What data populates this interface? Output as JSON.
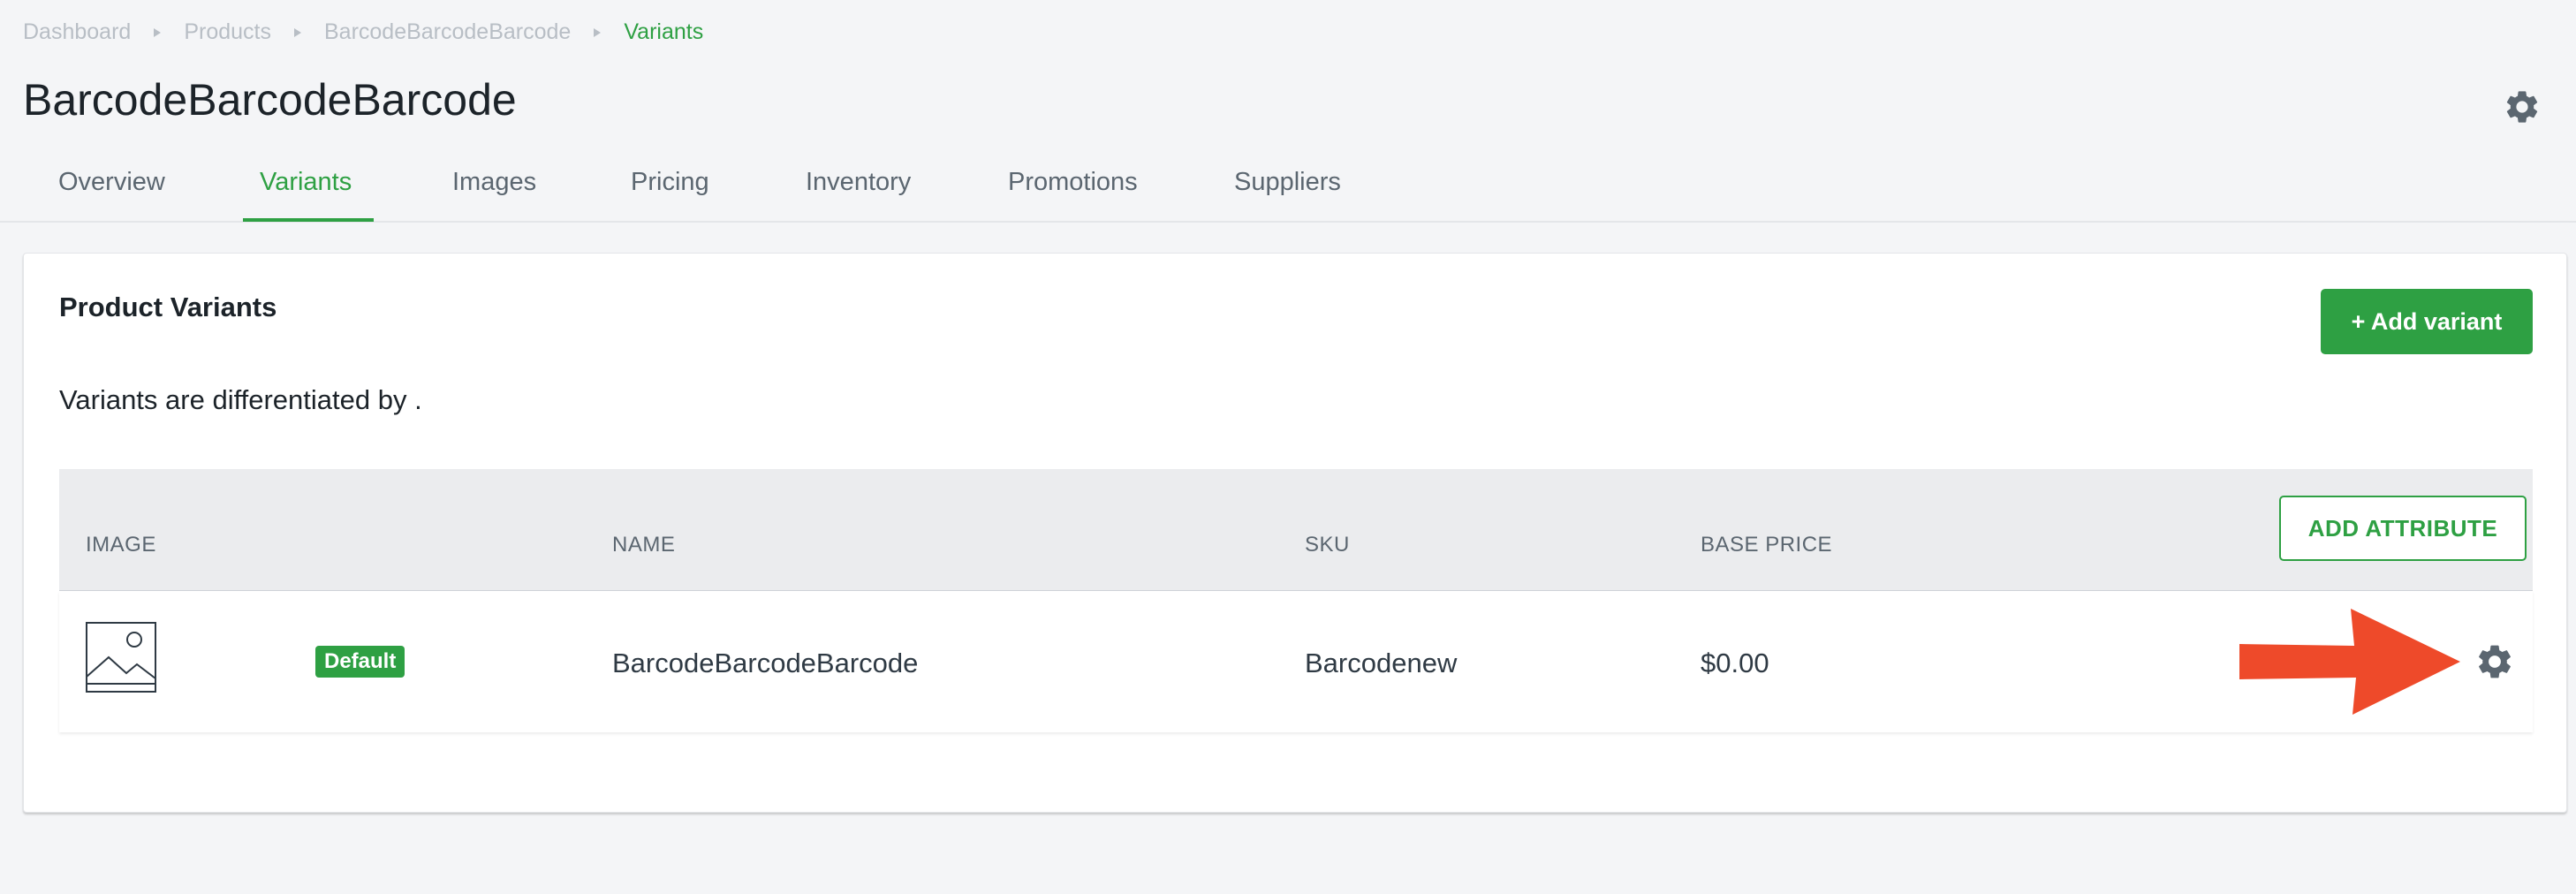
{
  "breadcrumb": [
    "Dashboard",
    "Products",
    "BarcodeBarcodeBarcode",
    "Variants"
  ],
  "page": {
    "title": "BarcodeBarcodeBarcode",
    "settings_icon": "gear-icon"
  },
  "tabs": [
    {
      "label": "Overview"
    },
    {
      "label": "Variants",
      "active": true
    },
    {
      "label": "Images"
    },
    {
      "label": "Pricing"
    },
    {
      "label": "Inventory"
    },
    {
      "label": "Promotions"
    },
    {
      "label": "Suppliers"
    }
  ],
  "card": {
    "title": "Product Variants",
    "add_variant_label": "+ Add variant",
    "differentiated_text": "Variants are differentiated by ."
  },
  "table": {
    "columns": [
      "IMAGE",
      "NAME",
      "SKU",
      "BASE PRICE"
    ],
    "add_attribute_label": "ADD ATTRIBUTE",
    "rows": [
      {
        "image_icon": "image-placeholder-icon",
        "badge": "Default",
        "name": "BarcodeBarcodeBarcode",
        "sku": "Barcodenew",
        "base_price": "$0.00",
        "action_icon": "gear-icon"
      }
    ]
  },
  "annotation": {
    "arrow_color": "#ee4a2a",
    "icon": "red-arrow-icon"
  },
  "colors": {
    "accent": "#2ea043",
    "text": "#212b36",
    "muted": "#5b6670",
    "background": "#f4f5f7"
  }
}
